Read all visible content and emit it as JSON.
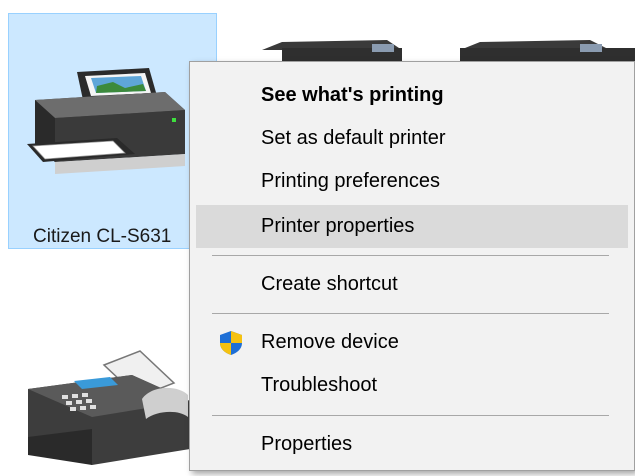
{
  "devices": [
    {
      "name": "Citizen CL-S631",
      "selected": true,
      "icon": "printer-icon"
    },
    {
      "name": "",
      "selected": false,
      "icon": "printer-icon"
    },
    {
      "name": "",
      "selected": false,
      "icon": "printer-icon"
    },
    {
      "name": "",
      "selected": false,
      "icon": "fax-icon"
    }
  ],
  "context_menu": {
    "items": [
      {
        "label": "See what's printing",
        "bold": true
      },
      {
        "label": "Set as default printer"
      },
      {
        "label": "Printing preferences"
      },
      {
        "label": "Printer properties",
        "highlighted": true
      },
      {
        "label": "Create shortcut"
      },
      {
        "label": "Remove device",
        "icon": "uac-shield-icon"
      },
      {
        "label": "Troubleshoot"
      },
      {
        "label": "Properties"
      }
    ]
  },
  "colors": {
    "selection_bg": "#cce8ff",
    "selection_border": "#99d1ff",
    "menu_bg": "#f2f2f2",
    "menu_hover": "#dadada"
  }
}
